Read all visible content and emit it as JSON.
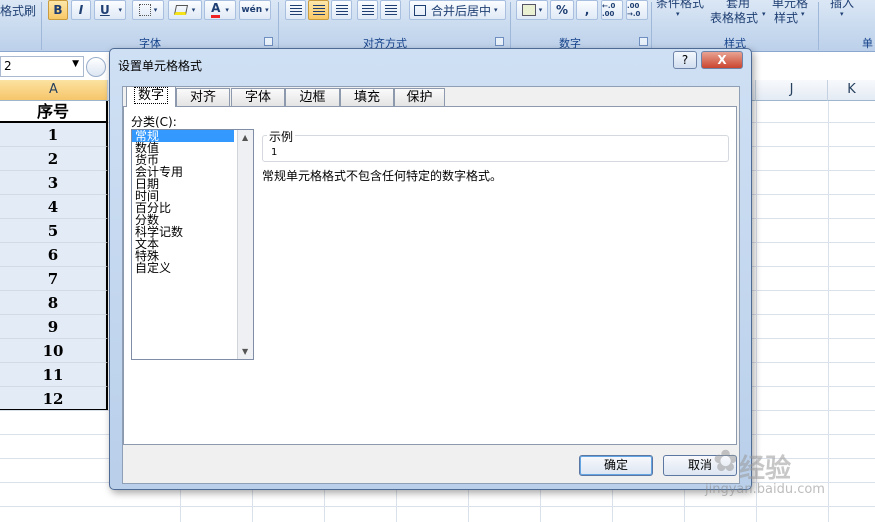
{
  "ribbon": {
    "format_painter": "格式刷",
    "bold": "B",
    "italic": "I",
    "underline": "U",
    "font_color_letter": "A",
    "phonetic": "wén",
    "merge_center": "合并后居中",
    "percent": "%",
    "comma": ",",
    "inc_decimal": "←.0 .00",
    "dec_decimal": ".00 →.0",
    "cond_format": "条件格式",
    "table_format_top": "套用",
    "table_format": "表格格式",
    "cell_style_top": "单元格",
    "cell_style": "样式",
    "insert": "插入",
    "group_font": "字体",
    "group_align": "对齐方式",
    "group_number": "数字",
    "group_style": "样式",
    "group_cells": "单"
  },
  "formula_bar": {
    "namebox": "2"
  },
  "sheet": {
    "columns": [
      "A",
      "J",
      "K"
    ],
    "header_cell": "序号",
    "rows": [
      "1",
      "2",
      "3",
      "4",
      "5",
      "6",
      "7",
      "8",
      "9",
      "10",
      "11",
      "12"
    ]
  },
  "dialog": {
    "title": "设置单元格格式",
    "help": "?",
    "close": "X",
    "tabs": [
      "数字",
      "对齐",
      "字体",
      "边框",
      "填充",
      "保护"
    ],
    "category_label": "分类(C):",
    "categories": [
      "常规",
      "数值",
      "货币",
      "会计专用",
      "日期",
      "时间",
      "百分比",
      "分数",
      "科学记数",
      "文本",
      "特殊",
      "自定义"
    ],
    "sample_legend": "示例",
    "sample_value": "1",
    "description": "常规单元格格式不包含任何特定的数字格式。",
    "ok": "确定",
    "cancel": "取消"
  },
  "watermark": {
    "logo": "经验",
    "url": "jingyan.baidu.com"
  }
}
